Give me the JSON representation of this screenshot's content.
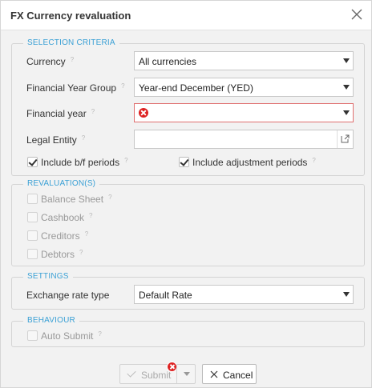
{
  "dialog": {
    "title": "FX Currency revaluation"
  },
  "icons": {
    "close": "close-icon",
    "lookup": "external-link-icon",
    "error": "error-icon",
    "help": "help-icon"
  },
  "selection": {
    "legend": "SELECTION CRITERIA",
    "currency": {
      "label": "Currency",
      "value": "All currencies"
    },
    "fy_group": {
      "label": "Financial Year Group",
      "value": "Year-end December (YED)"
    },
    "fin_year": {
      "label": "Financial year",
      "value": ""
    },
    "legal_entity": {
      "label": "Legal Entity",
      "value": ""
    },
    "include_bf": {
      "label": "Include b/f periods",
      "checked": true
    },
    "include_adj": {
      "label": "Include adjustment periods",
      "checked": true
    }
  },
  "revaluations": {
    "legend": "REVALUATION(S)",
    "items": [
      {
        "label": "Balance Sheet",
        "checked": false
      },
      {
        "label": "Cashbook",
        "checked": false
      },
      {
        "label": "Creditors",
        "checked": false
      },
      {
        "label": "Debtors",
        "checked": false
      }
    ]
  },
  "settings": {
    "legend": "SETTINGS",
    "rate_type": {
      "label": "Exchange rate type",
      "value": "Default Rate"
    }
  },
  "behaviour": {
    "legend": "BEHAVIOUR",
    "auto_submit": {
      "label": "Auto Submit",
      "checked": false
    }
  },
  "help_mark": "?",
  "footer": {
    "submit_label": "Submit",
    "cancel_label": "Cancel"
  },
  "colors": {
    "legend": "#3aa0d5",
    "error": "#dd2222"
  }
}
